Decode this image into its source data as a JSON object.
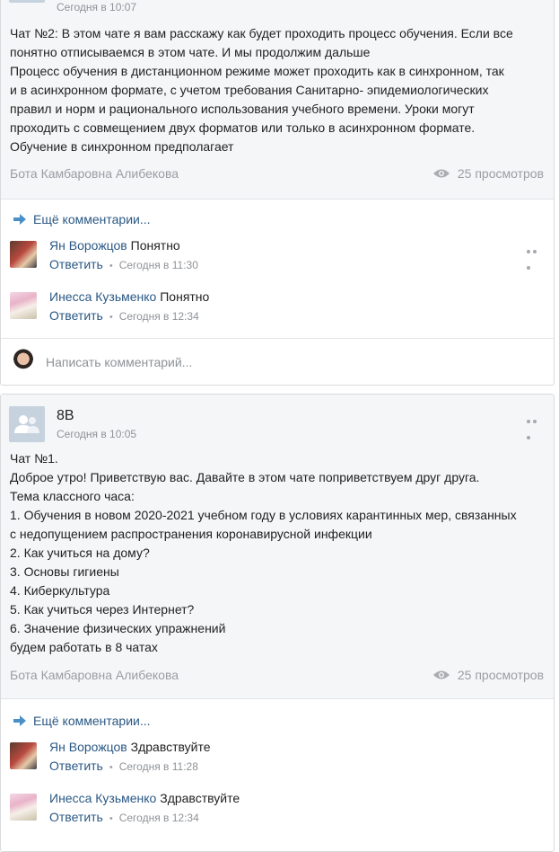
{
  "post1": {
    "time": "Сегодня в 10:07",
    "lines": [
      "Чат №2: В этом чате я вам расскажу как будет проходить процесс обучения. Если все",
      "понятно отписываемся в этом чате. И мы продолжим дальше",
      "Процесс обучения в дистанционном режиме может проходить как в синхронном, так",
      "и в асинхронном формате, с учетом требования Санитарно- эпидемиологических",
      "правил и норм и рационального использования учебного времени. Уроки могут",
      "проходить с совмещением двух форматов или только в асинхронном формате.",
      "Обучение в синхронном предполагает"
    ],
    "author": "Бота Камбаровна Алибекова",
    "views": "25 просмотров",
    "more_comments": "Ещё комментарии...",
    "comments": [
      {
        "name": "Ян Ворожцов",
        "text": "Понятно",
        "reply": "Ответить",
        "time": "Сегодня в 11:30"
      },
      {
        "name": "Инесса Кузьменко",
        "text": "Понятно",
        "reply": "Ответить",
        "time": "Сегодня в 12:34"
      }
    ],
    "write_placeholder": "Написать комментарий..."
  },
  "post2": {
    "group": "8В",
    "time": "Сегодня в 10:05",
    "lines": [
      "Чат №1.",
      "Доброе утро! Приветствую вас. Давайте в этом чате поприветствуем друг друга.",
      "Тема классного часа:",
      "1. Обучения в новом 2020-2021 учебном году в условиях карантинных мер, связанных",
      "с недопущением распространения коронавирусной инфекции",
      "2. Как учиться на дому?",
      "3. Основы гигиены",
      "4. Киберкультура",
      "5. Как учиться через Интернет?",
      "6. Значение физических упражнений",
      "будем работать в 8 чатах"
    ],
    "author": "Бота Камбаровна Алибекова",
    "views": "25 просмотров",
    "more_comments": "Ещё комментарии...",
    "comments": [
      {
        "name": "Ян Ворожцов",
        "text": "Здравствуйте",
        "reply": "Ответить",
        "time": "Сегодня в 11:28"
      },
      {
        "name": "Инесса Кузьменко",
        "text": "Здравствуйте",
        "reply": "Ответить",
        "time": "Сегодня в 12:34"
      }
    ]
  },
  "icons": {
    "group_avatar": "group-icon",
    "views": "eye-icon",
    "more_comments": "arrow-right-icon",
    "menu": "more-dots-icon"
  },
  "colors": {
    "link": "#2a5885",
    "muted": "#8e9297",
    "post_bg": "#f5f6f8",
    "border": "#d8dadd"
  }
}
